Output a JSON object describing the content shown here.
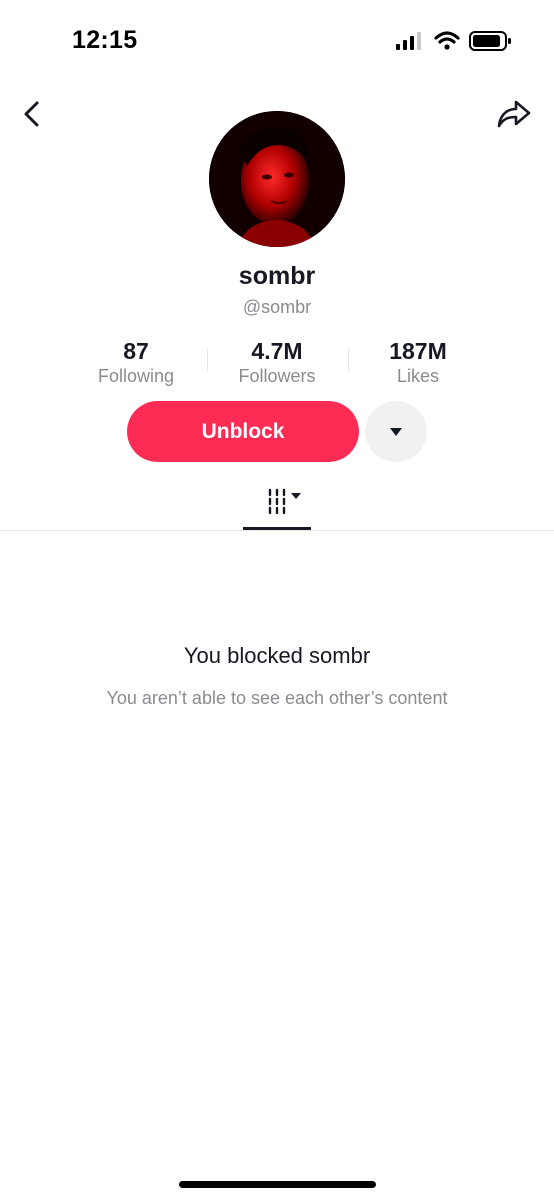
{
  "status_bar": {
    "time": "12:15",
    "icons": [
      "signal-icon",
      "wifi-icon",
      "battery-icon"
    ]
  },
  "nav": {
    "back_icon": "chevron-left-icon",
    "share_icon": "share-icon"
  },
  "profile": {
    "display_name": "sombr",
    "handle": "@sombr"
  },
  "stats": [
    {
      "value": "87",
      "label": "Following"
    },
    {
      "value": "4.7M",
      "label": "Followers"
    },
    {
      "value": "187M",
      "label": "Likes"
    }
  ],
  "actions": {
    "unblock_label": "Unblock",
    "more_icon": "caret-down-icon"
  },
  "tabs": {
    "active_icon": "grid-icon"
  },
  "empty_state": {
    "title": "You blocked sombr",
    "subtitle": "You aren’t able to see each other’s content"
  },
  "colors": {
    "accent": "#fe2c55",
    "text_primary": "#161823",
    "text_secondary": "#8a8b91"
  }
}
